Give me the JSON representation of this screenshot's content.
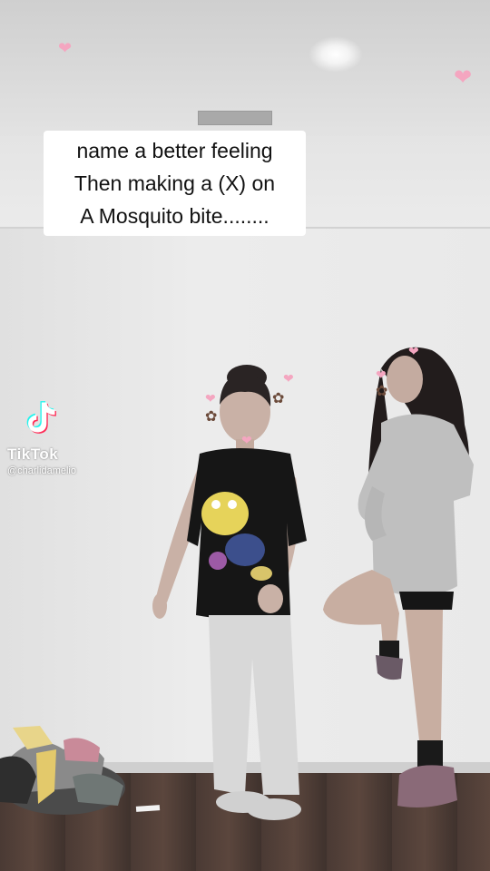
{
  "caption": {
    "lines": [
      "name a better feeling",
      "Then making a (X) on",
      "A Mosquito bite........"
    ]
  },
  "watermark": {
    "brand": "TikTok",
    "handle": "@charlidamelio",
    "logo_icon": "tiktok-logo-icon"
  },
  "colors": {
    "caption_bg": "#ffffff",
    "caption_text": "#111111",
    "sticker_pink": "#f4a6c0"
  }
}
